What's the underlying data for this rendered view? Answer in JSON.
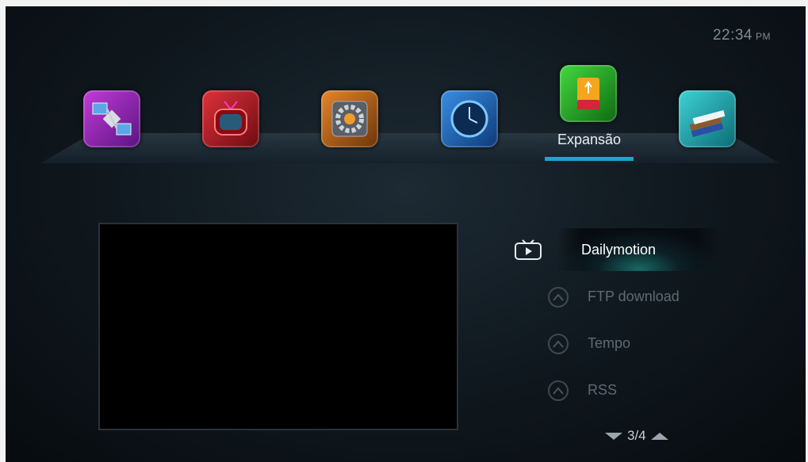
{
  "clock": {
    "time": "22:34",
    "ampm": "PM"
  },
  "top_menu": {
    "items": [
      {
        "icon": "satellite-icon"
      },
      {
        "icon": "tv-icon"
      },
      {
        "icon": "settings-gear-icon"
      },
      {
        "icon": "clock-icon"
      },
      {
        "icon": "usb-drive-icon",
        "label": "Expansão",
        "selected": true
      },
      {
        "icon": "books-icon"
      }
    ]
  },
  "submenu": {
    "items": [
      {
        "label": "Dailymotion",
        "selected": true,
        "icon": "play-tv-icon"
      },
      {
        "label": "FTP download",
        "icon": "circle-chevron-icon"
      },
      {
        "label": "Tempo",
        "icon": "circle-chevron-icon"
      },
      {
        "label": "RSS",
        "icon": "circle-chevron-icon"
      }
    ]
  },
  "pager": {
    "text": "3/4"
  },
  "colors": {
    "accent": "#19a7c9",
    "selected_glow": "#24b4aa"
  }
}
